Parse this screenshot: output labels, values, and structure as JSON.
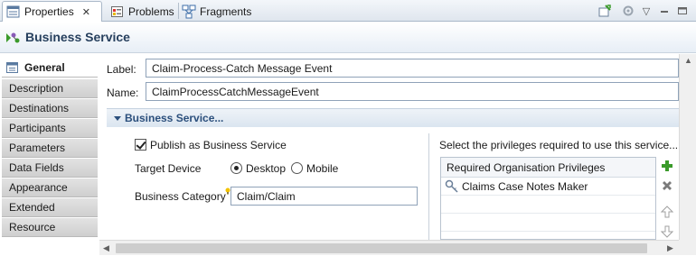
{
  "tabs": [
    {
      "label": "Properties",
      "active": true,
      "icon": "properties-icon"
    },
    {
      "label": "Problems",
      "active": false,
      "icon": "problems-icon"
    },
    {
      "label": "Fragments",
      "active": false,
      "icon": "fragments-icon"
    }
  ],
  "header": {
    "title": "Business Service",
    "icon": "business-service-icon"
  },
  "nav": {
    "items": [
      {
        "label": "General",
        "selected": true
      },
      {
        "label": "Description"
      },
      {
        "label": "Destinations"
      },
      {
        "label": "Participants"
      },
      {
        "label": "Parameters"
      },
      {
        "label": "Data Fields"
      },
      {
        "label": "Appearance"
      },
      {
        "label": "Extended"
      },
      {
        "label": "Resource"
      }
    ]
  },
  "form": {
    "label_caption": "Label:",
    "label_value": "Claim-Process-Catch Message Event",
    "name_caption": "Name:",
    "name_value": "ClaimProcessCatchMessageEvent"
  },
  "section": {
    "title": "Business Service...",
    "publish_label": "Publish as Business Service",
    "publish_checked": true,
    "target_device_label": "Target Device",
    "device_options": [
      "Desktop",
      "Mobile"
    ],
    "device_selected": "Desktop",
    "category_label": "Business Category",
    "category_value": "Claim/Claim",
    "privileges_prompt": "Select the privileges required to use this service...",
    "privileges_header": "Required Organisation Privileges",
    "privileges": [
      "Claims Case Notes Maker"
    ]
  },
  "colors": {
    "accent": "#2b4f7c",
    "add": "#3a9a2a",
    "remove": "#6a6a6a"
  }
}
